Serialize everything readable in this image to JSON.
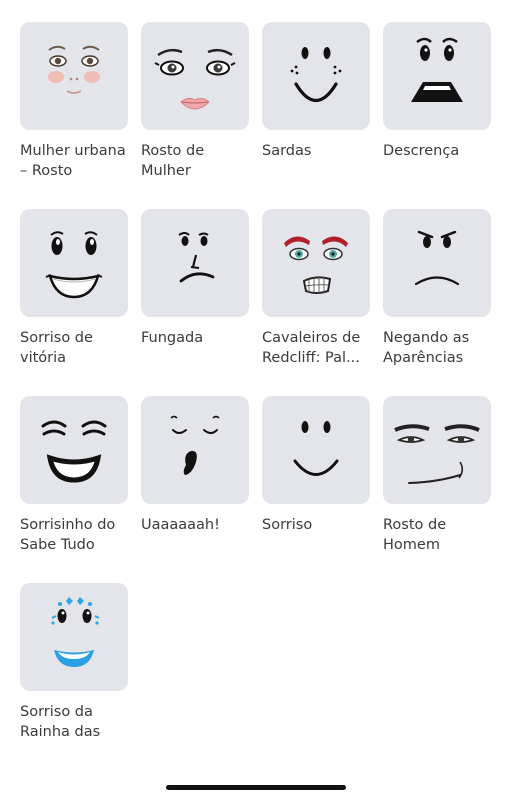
{
  "items": [
    {
      "line1": "Mulher urbana",
      "line2": "– Rosto",
      "icon": "urban-woman-face-icon"
    },
    {
      "line1": "Rosto de",
      "line2": "Mulher",
      "icon": "woman-face-icon"
    },
    {
      "line1": "Sardas",
      "line2": "",
      "icon": "freckles-face-icon"
    },
    {
      "line1": "Descrença",
      "line2": "",
      "icon": "disbelief-face-icon"
    },
    {
      "line1": "Sorriso de",
      "line2": "vitória",
      "icon": "victory-smile-face-icon"
    },
    {
      "line1": "Fungada",
      "line2": "",
      "icon": "sniff-face-icon"
    },
    {
      "line1": "Cavaleiros de",
      "line2": "Redcliff: Pal...",
      "icon": "redcliff-knight-face-icon"
    },
    {
      "line1": "Negando as",
      "line2": "Aparências",
      "icon": "denial-face-icon"
    },
    {
      "line1": "Sorrisinho do",
      "line2": "Sabe Tudo",
      "icon": "know-it-all-grin-face-icon"
    },
    {
      "line1": "Uaaaaaah!",
      "line2": "",
      "icon": "yawn-face-icon"
    },
    {
      "line1": "Sorriso",
      "line2": "",
      "icon": "smile-face-icon"
    },
    {
      "line1": "Rosto de",
      "line2": "Homem",
      "icon": "man-face-icon"
    },
    {
      "line1": "Sorriso da",
      "line2": "Rainha das",
      "icon": "snow-queen-smile-face-icon"
    }
  ]
}
